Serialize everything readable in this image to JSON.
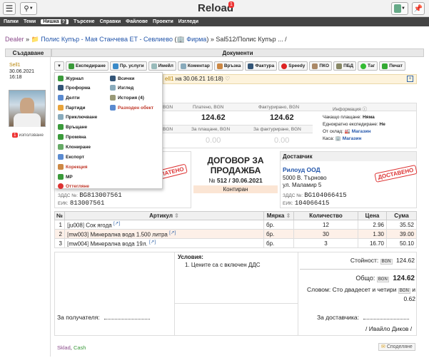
{
  "app": {
    "title": "Reload",
    "notifications": "1"
  },
  "nav": [
    "Папки",
    "Теми",
    "Нишка",
    "Търсене",
    "Справки",
    "Файлове",
    "Проекти",
    "Изгледи"
  ],
  "nav_badge": "?",
  "breadcrumb": {
    "dealer": "Dealer",
    "sep": "»",
    "client": "Полис Купър - Мая Станчева ЕТ - Севлиево",
    "firm": "Фирма",
    "doc": "Sal512/Полис Купър ... /"
  },
  "headers": {
    "created": "Създаване",
    "documents": "Документи"
  },
  "creator": {
    "name": "Sell1",
    "date": "30.06.2021",
    "time": "16:18",
    "usage_count": "1",
    "usage_label": "използване"
  },
  "toolbar": [
    "Експедиране",
    "Пр. услуги",
    "Имейл",
    "Коментар",
    "Връзка",
    "Фактура",
    "Speedy",
    "ПКО",
    "ПБД",
    "Таг",
    "Печат"
  ],
  "dropdown": {
    "left": [
      "Журнал",
      "Проформа",
      "Делти",
      "Партиди",
      "Приключване",
      "Връщане",
      "Промяна",
      "Клониране",
      "Експорт",
      "Корекция",
      "МР",
      "Оттегляне"
    ],
    "right": [
      "Всички",
      "Изглед",
      "История (4)",
      "Разходен обект"
    ]
  },
  "status_line": {
    "user": "ell1",
    "date": "на 30.06.21 16:18)"
  },
  "amounts": {
    "paid_label": "Платено, BGN",
    "paid": "124.62",
    "invoiced_label": "Фактурирано, BGN",
    "invoiced": "124.62",
    "currency_frag": "BGN",
    "currency_frag2": "BGN",
    "to_pay_label": "За плащане, BGN",
    "to_pay": "0.00",
    "to_invoice_label": "За фактуриране, BGN",
    "to_invoice": "0.00",
    "info_label": "Информация"
  },
  "info": {
    "waiting_label": "Чакащо плащане:",
    "waiting": "Няма",
    "oneoff_label": "Еднократно експедиране:",
    "oneoff": "Не",
    "warehouse_label": "От склад:",
    "warehouse": "Магазин",
    "cashbox_label": "Каса:",
    "cashbox": "Магазин"
  },
  "contract": {
    "title1": "ДОГОВОР ЗА",
    "title2": "ПРОДАЖБА",
    "num_prefix": "№",
    "num": "512",
    "slash": "/",
    "date": "30.06.2021",
    "state": "Контиран"
  },
  "buyer": {
    "stamp": "ПЛАТЕНО",
    "vat_label": "ЗДДС №:",
    "vat": "BG813007561",
    "eik_label": "ЕИК:",
    "eik": "813007561"
  },
  "supplier": {
    "header": "Доставчик",
    "name": "Рилоуд ООД",
    "addr1": "5000 В. Търново",
    "addr2": "ул. Маламир 5",
    "stamp": "ДОСТАВЕНО",
    "vat_label": "ЗДДС №:",
    "vat": "BG104066415",
    "eik_label": "ЕИК:",
    "eik": "104066415"
  },
  "table": {
    "headers": [
      "№",
      "Артикул",
      "Мярка",
      "Количество",
      "Цена",
      "Сума"
    ],
    "rows": [
      {
        "n": "1",
        "code": "ju008",
        "name": "Сок ягода",
        "unit": "бр.",
        "qty": "12",
        "price": "2.96",
        "sum": "35.52"
      },
      {
        "n": "2",
        "code": "mw003",
        "name": "Минерална вода 1.500 литра",
        "unit": "бр.",
        "qty": "30",
        "price": "1.30",
        "sum": "39.00"
      },
      {
        "n": "3",
        "code": "mw004",
        "name": "Минерална вода 19л.",
        "unit": "бр.",
        "qty": "3",
        "price": "16.70",
        "sum": "50.10"
      }
    ]
  },
  "conditions": {
    "title": "Условия:",
    "item": "1. Цените са с включен ДДС"
  },
  "totals": {
    "value_label": "Стойност:",
    "currency": "BGN",
    "value": "124.62",
    "total_label": "Общо:",
    "total": "124.62",
    "words_label": "Словом:",
    "words": "Сто двадесет и четири",
    "words_tail": "и",
    "words_cents": "0.62"
  },
  "signatures": {
    "receiver": "За получателя:",
    "supplier": "За доставчика:",
    "supplier_name": "/ Ивайло Диков /"
  },
  "footer": {
    "tag1": "Sklad",
    "tag2": "Cash",
    "share": "Споделяне"
  }
}
